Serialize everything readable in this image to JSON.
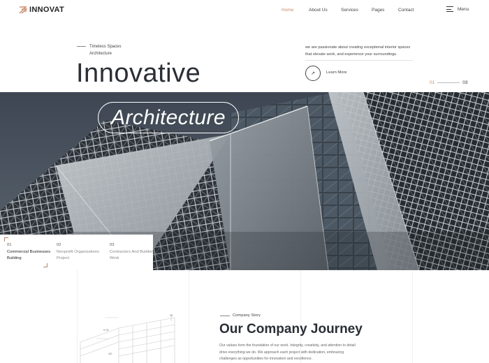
{
  "header": {
    "logo_text": "INNOVAT",
    "nav": [
      {
        "label": "Home",
        "active": true
      },
      {
        "label": "About Us",
        "active": false
      },
      {
        "label": "Services",
        "active": false
      },
      {
        "label": "Pages",
        "active": false
      },
      {
        "label": "Contact",
        "active": false
      }
    ],
    "menu_label": "Menu",
    "menu_icon": "hamburger-icon",
    "accent_color": "#c98a6a"
  },
  "hero": {
    "tagline": [
      "Timeless Spaces",
      "Architecture"
    ],
    "title": "Innovative",
    "description": "we are passionate about creating exceptional interior spaces that elevate work, and experience your surroundings.",
    "learn_more_label": "Learn More",
    "learn_more_icon": "arrow-up-right-icon",
    "slide_current": "01",
    "slide_total": "03",
    "image_overlay_text": "Architecture"
  },
  "projects": [
    {
      "num": "01",
      "title": "Commercial Businesses Building",
      "active": true
    },
    {
      "num": "02",
      "title": "Nonprofit Organizations Project",
      "active": false
    },
    {
      "num": "03",
      "title": "Contractors And Builders Work",
      "active": false
    }
  ],
  "company_story": {
    "label": "Company Story",
    "title": "Our Company Journey",
    "description": "Our values form the foundation of our work. Integrity, creativity, and attention to detail drive everything we do. We approach each project with dedication, embracing challenges as opportunities for innovation and excellence.",
    "sketch_labels": [
      "0.00",
      "AD",
      "10"
    ]
  }
}
